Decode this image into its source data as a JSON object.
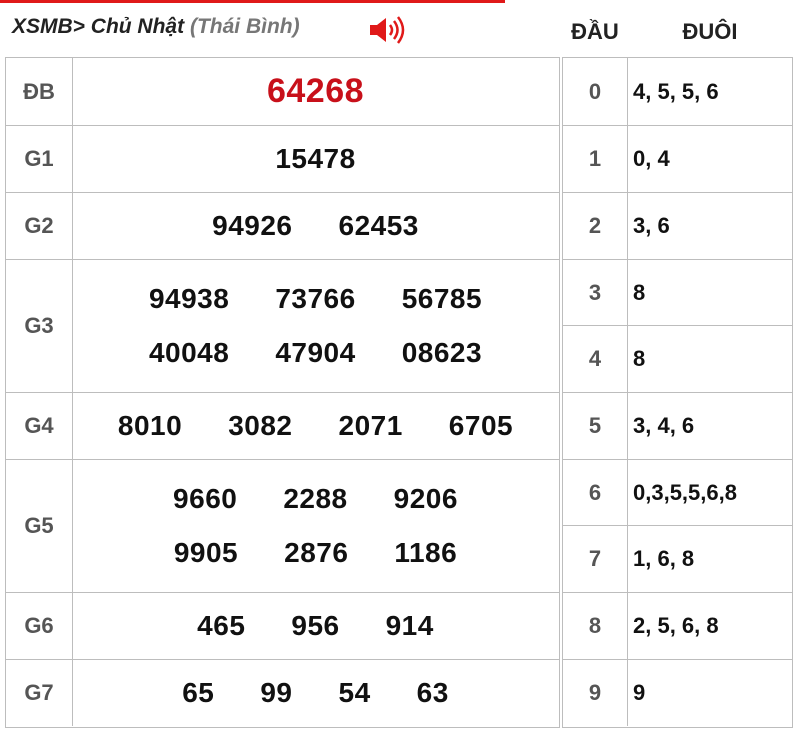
{
  "header": {
    "prefix": "XSMB>",
    "day": "Chủ Nhật",
    "province": "(Thái Bình)",
    "speaker_icon": "speaker-icon",
    "col_dau": "ĐẦU",
    "col_duoi": "ĐUÔI"
  },
  "colors": {
    "accent": "#c8101a",
    "border": "#bdbdbd",
    "label": "#555555"
  },
  "prizes": [
    {
      "label": "ĐB",
      "lines": [
        [
          "64268"
        ]
      ]
    },
    {
      "label": "G1",
      "lines": [
        [
          "15478"
        ]
      ]
    },
    {
      "label": "G2",
      "lines": [
        [
          "94926",
          "62453"
        ]
      ]
    },
    {
      "label": "G3",
      "lines": [
        [
          "94938",
          "73766",
          "56785"
        ],
        [
          "40048",
          "47904",
          "08623"
        ]
      ]
    },
    {
      "label": "G4",
      "lines": [
        [
          "8010",
          "3082",
          "2071",
          "6705"
        ]
      ]
    },
    {
      "label": "G5",
      "lines": [
        [
          "9660",
          "2288",
          "9206"
        ],
        [
          "9905",
          "2876",
          "1186"
        ]
      ]
    },
    {
      "label": "G6",
      "lines": [
        [
          "465",
          "956",
          "914"
        ]
      ]
    },
    {
      "label": "G7",
      "lines": [
        [
          "65",
          "99",
          "54",
          "63"
        ]
      ]
    }
  ],
  "loto": [
    {
      "dau": "0",
      "duoi": "4, 5, 5, 6"
    },
    {
      "dau": "1",
      "duoi": "0, 4"
    },
    {
      "dau": "2",
      "duoi": "3, 6"
    },
    {
      "dau": "3",
      "duoi": "8"
    },
    {
      "dau": "4",
      "duoi": "8"
    },
    {
      "dau": "5",
      "duoi": "3, 4, 6"
    },
    {
      "dau": "6",
      "duoi": "0,3,5,5,6,8"
    },
    {
      "dau": "7",
      "duoi": "1, 6, 8"
    },
    {
      "dau": "8",
      "duoi": "2, 5, 6, 8"
    },
    {
      "dau": "9",
      "duoi": "9"
    }
  ]
}
